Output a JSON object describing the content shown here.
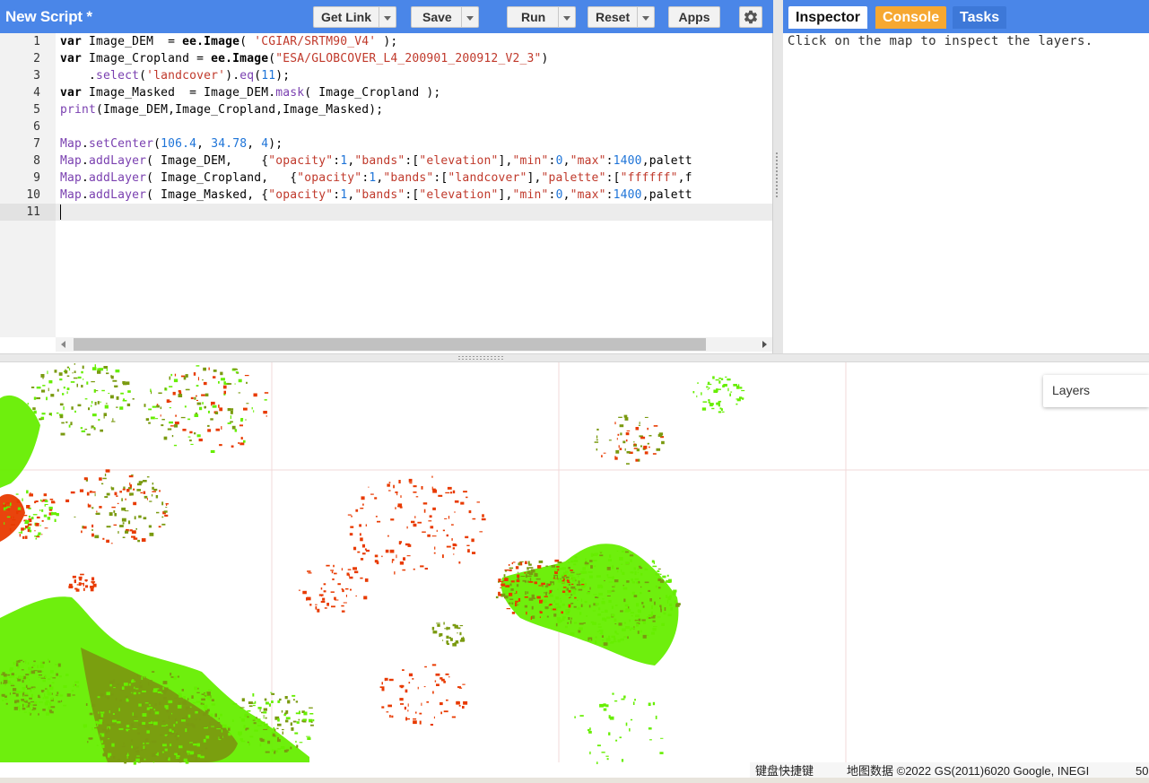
{
  "editor": {
    "title": "New Script *",
    "buttons": {
      "get_link": "Get Link",
      "save": "Save",
      "run": "Run",
      "reset": "Reset",
      "apps": "Apps"
    },
    "line_numbers": [
      "1",
      "2",
      "3",
      "4",
      "5",
      "6",
      "7",
      "8",
      "9",
      "10",
      "11"
    ],
    "code_lines": [
      "var Image_DEM  = ee.Image( 'CGIAR/SRTM90_V4' );",
      "var Image_Cropland = ee.Image(\"ESA/GLOBCOVER_L4_200901_200912_V2_3\")",
      "    .select('landcover').eq(11);",
      "var Image_Masked  = Image_DEM.mask( Image_Cropland );",
      "print(Image_DEM,Image_Cropland,Image_Masked);",
      "",
      "Map.setCenter(106.4, 34.78, 4);",
      "Map.addLayer( Image_DEM,    {\"opacity\":1,\"bands\":[\"elevation\"],\"min\":0,\"max\":1400,\"palett",
      "Map.addLayer( Image_Cropland,   {\"opacity\":1,\"bands\":[\"landcover\"],\"palette\":[\"ffffff\",\"f",
      "Map.addLayer( Image_Masked, {\"opacity\":1,\"bands\":[\"elevation\"],\"min\":0,\"max\":1400,\"palett",
      ""
    ],
    "active_line": 11
  },
  "right_panel": {
    "tabs": [
      "Inspector",
      "Console",
      "Tasks"
    ],
    "active_tab": "Inspector",
    "message": "Click on the map to inspect the layers."
  },
  "map": {
    "layers_button": "Layers",
    "attribution": {
      "shortcuts": "键盘快捷键",
      "data": "地图数据 ©2022 GS(2011)6020 Google, INEGI",
      "scale": "50"
    }
  },
  "colors": {
    "header_blue": "#4a86e8",
    "console_tab": "#f6a831",
    "dem_low": "#66ee00",
    "dem_mid": "#7a9a10",
    "dem_high": "#e83a00"
  }
}
